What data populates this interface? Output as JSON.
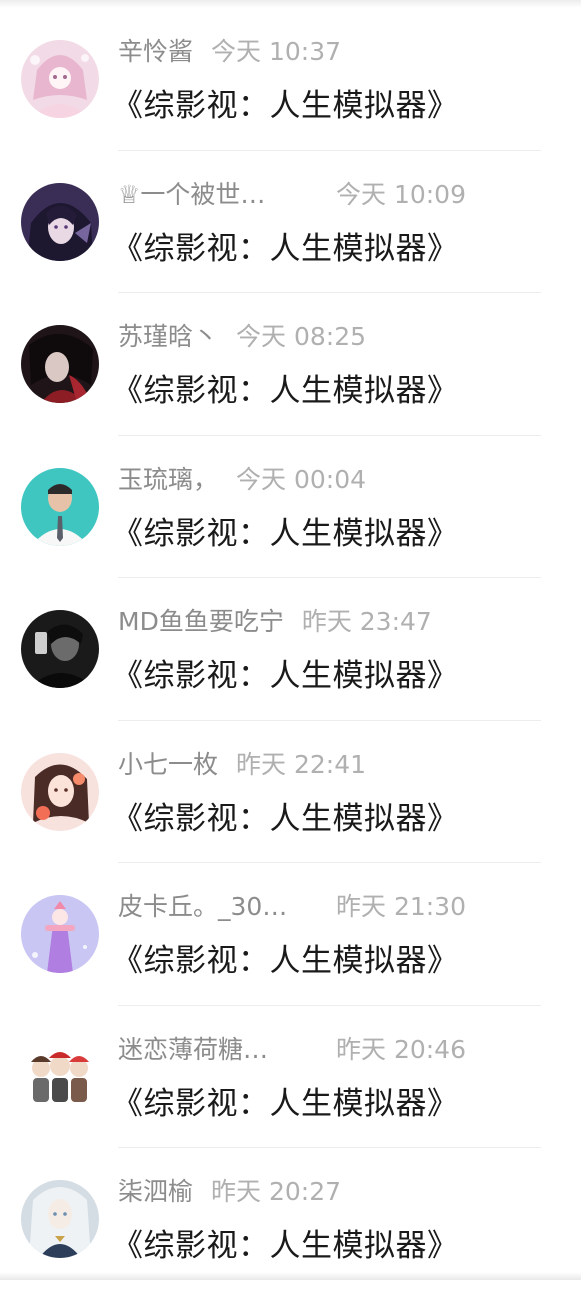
{
  "comments": [
    {
      "name": "辛怜酱",
      "time": "今天 10:37",
      "message": "《综影视：人生模拟器》",
      "avatar": "avatar-pink-anime-girl",
      "avatar_color": "#e8c6d6"
    },
    {
      "name": "♕一个被世…",
      "time": "今天 10:09",
      "message": "《综影视：人生模拟器》",
      "avatar": "avatar-anime-boy-purple",
      "avatar_color": "#3b2f5a"
    },
    {
      "name": "苏瑾晗丶",
      "time": "今天 08:25",
      "message": "《综影视：人生模拟器》",
      "avatar": "avatar-dark-red-character",
      "avatar_color": "#2a1a1e"
    },
    {
      "name": "玉琉璃，",
      "time": "今天 00:04",
      "message": "《综影视：人生模拟器》",
      "avatar": "avatar-man-teal-background",
      "avatar_color": "#3cc7c1"
    },
    {
      "name": "MD鱼鱼要吃宁",
      "time": "昨天 23:47",
      "message": "《综影视：人生模拟器》",
      "avatar": "avatar-dark-phone-photo",
      "avatar_color": "#222222"
    },
    {
      "name": "小七一枚",
      "time": "昨天 22:41",
      "message": "《综影视：人生模拟器》",
      "avatar": "avatar-girl-flower",
      "avatar_color": "#f3c9c4"
    },
    {
      "name": "皮卡丘。_30…",
      "time": "昨天 21:30",
      "message": "《综影视：人生模拟器》",
      "avatar": "avatar-purple-princess",
      "avatar_color": "#c9c6f2"
    },
    {
      "name": "迷恋薄荷糖…",
      "time": "昨天 20:46",
      "message": "《综影视：人生模拟器》",
      "avatar": "avatar-group-chibi",
      "avatar_color": "#f5f5f5"
    },
    {
      "name": "柒泗榆",
      "time": "昨天 20:27",
      "message": "《综影视：人生模拟器》",
      "avatar": "avatar-white-hair-character",
      "avatar_color": "#c8d3dc"
    }
  ]
}
